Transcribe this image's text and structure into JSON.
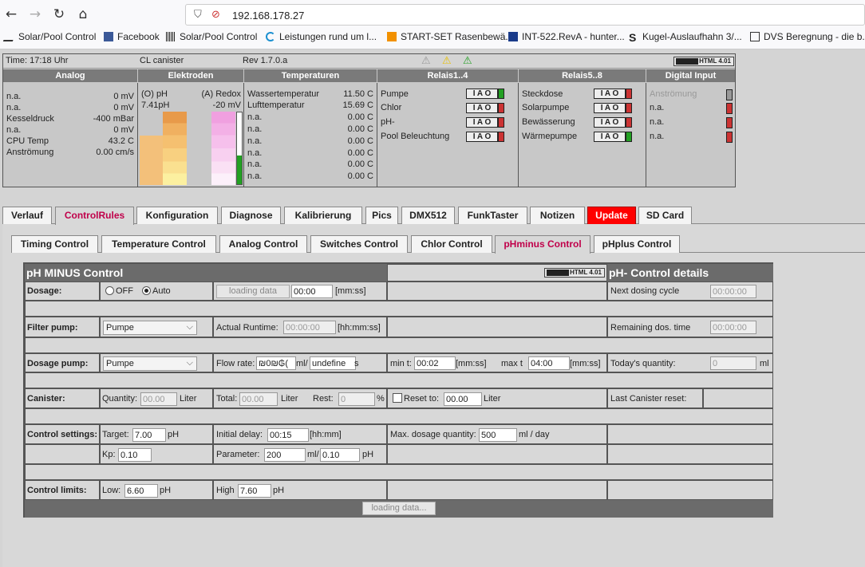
{
  "browser": {
    "url": "192.168.178.27",
    "bookmarks": [
      {
        "label": "Solar/Pool Control",
        "icon": "pool-icon"
      },
      {
        "label": "Facebook",
        "icon": "facebook-icon"
      },
      {
        "label": "Solar/Pool Control",
        "icon": "barcode-icon"
      },
      {
        "label": "Leistungen rund um l...",
        "icon": "loop-icon"
      },
      {
        "label": "START-SET Rasenbewä...",
        "icon": "shop-icon"
      },
      {
        "label": "INT-522.RevA - hunter...",
        "icon": "mail-icon"
      },
      {
        "label": "Kugel-Auslaufhahn 3/...",
        "icon": "s-icon"
      },
      {
        "label": "DVS Beregnung - die b...",
        "icon": "dvs-icon"
      }
    ]
  },
  "status": {
    "time": "Time: 17:18 Uhr",
    "mode": "CL canister",
    "rev": "Rev 1.7.0.a",
    "logo": "HTML 4.01"
  },
  "headers": {
    "analog": "Analog",
    "elektroden": "Elektroden",
    "temperaturen": "Temperaturen",
    "relais1": "Relais1..4",
    "relais2": "Relais5..8",
    "digital": "Digital Input"
  },
  "analog": [
    {
      "name": "n.a.",
      "value": "0 mV"
    },
    {
      "name": "n.a.",
      "value": "0 mV"
    },
    {
      "name": "Kesseldruck",
      "value": "-400 mBar"
    },
    {
      "name": "n.a.",
      "value": "0 mV"
    },
    {
      "name": "CPU Temp",
      "value": "43.2 C"
    },
    {
      "name": "Anströmung",
      "value": "0.00 cm/s"
    }
  ],
  "elektroden": {
    "ph_label": "(O) pH",
    "ph_value": "7.41pH",
    "redox_label": "(A) Redox",
    "redox_value": "-20 mV"
  },
  "temps": [
    {
      "name": "Wassertemperatur",
      "value": "11.50 C"
    },
    {
      "name": "Lufttemperatur",
      "value": "15.69 C"
    },
    {
      "name": "n.a.",
      "value": "0.00 C"
    },
    {
      "name": "n.a.",
      "value": "0.00 C"
    },
    {
      "name": "n.a.",
      "value": "0.00 C"
    },
    {
      "name": "n.a.",
      "value": "0.00 C"
    },
    {
      "name": "n.a.",
      "value": "0.00 C"
    },
    {
      "name": "n.a.",
      "value": "0.00 C"
    }
  ],
  "relais1": [
    "Pumpe",
    "Chlor",
    "pH-",
    "Pool Beleuchtung"
  ],
  "relais2": [
    "Steckdose",
    "Solarpumpe",
    "Bewässerung",
    "Wärmepumpe"
  ],
  "iao": "I A O",
  "digital": [
    "Anströmung",
    "n.a.",
    "n.a.",
    "n.a."
  ],
  "tabs_main": [
    "Verlauf",
    "ControlRules",
    "Konfiguration",
    "Diagnose",
    "Kalibrierung",
    "Pics",
    "DMX512",
    "FunkTaster",
    "Notizen",
    "Update",
    "SD Card"
  ],
  "tabs_sub": [
    "Timing Control",
    "Temperature Control",
    "Analog Control",
    "Switches Control",
    "Chlor Control",
    "pHminus Control",
    "pHplus Control"
  ],
  "control": {
    "title": "pH MINUS Control",
    "details_title": "pH- Control details",
    "logo": "HTML 4.01",
    "dosage_label": "Dosage:",
    "off": "OFF",
    "auto": "Auto",
    "loading_btn": "loading data",
    "dosage_time": "00:00",
    "mmss": "[mm:ss]",
    "filter_label": "Filter pump:",
    "filter_value": "Pumpe",
    "runtime_label": "Actual Runtime:",
    "runtime_value": "00:00:00",
    "hhmmss": "[hh:mm:ss]",
    "dpump_label": "Dosage pump:",
    "dpump_value": "Pumpe",
    "flow_label": "Flow rate:",
    "flow_value": "₪0₪₲(",
    "flow_unit": "ml/",
    "flow_undef": "undefine",
    "flow_s": "s",
    "min_label": "min t:",
    "min_value": "00:02",
    "max_label": "max t",
    "max_value": "04:00",
    "canister_label": "Canister:",
    "qty_label": "Quantity:",
    "qty_value": "00.00",
    "liter": "Liter",
    "total_label": "Total:",
    "total_value": "00.00",
    "rest_label": "Rest:",
    "rest_value": "0",
    "pct": "%",
    "reset_label": "Reset to:",
    "reset_value": "00.00",
    "settings_label": "Control settings:",
    "target_label": "Target:",
    "target_value": "7.00",
    "ph": "pH",
    "delay_label": "Initial delay:",
    "delay_value": "00:15",
    "hhmm": "[hh:mm]",
    "maxdose_label": "Max. dosage quantity:",
    "maxdose_value": "500",
    "mlday": "ml / day",
    "kp_label": "Kp:",
    "kp_value": "0.10",
    "param_label": "Parameter:",
    "param_value": "200",
    "param_unit": "ml/",
    "param_value2": "0.10",
    "limits_label": "Control limits:",
    "low_label": "Low:",
    "low_value": "6.60",
    "high_label": "High",
    "high_value": "7.60",
    "loading_footer": "loading data...",
    "next_label": "Next dosing cycle",
    "next_value": "00:00:00",
    "remaining_label": "Remaining dos. time",
    "remaining_value": "00:00:00",
    "today_label": "Today's quantity:",
    "today_value": "0",
    "ml": "ml",
    "lastreset_label": "Last Canister reset:"
  },
  "colors": {
    "relay_red": "#cc3333",
    "relay_green": "#33aa33",
    "update_tab": "#ff0000",
    "header_gray": "#6b6b6b"
  }
}
